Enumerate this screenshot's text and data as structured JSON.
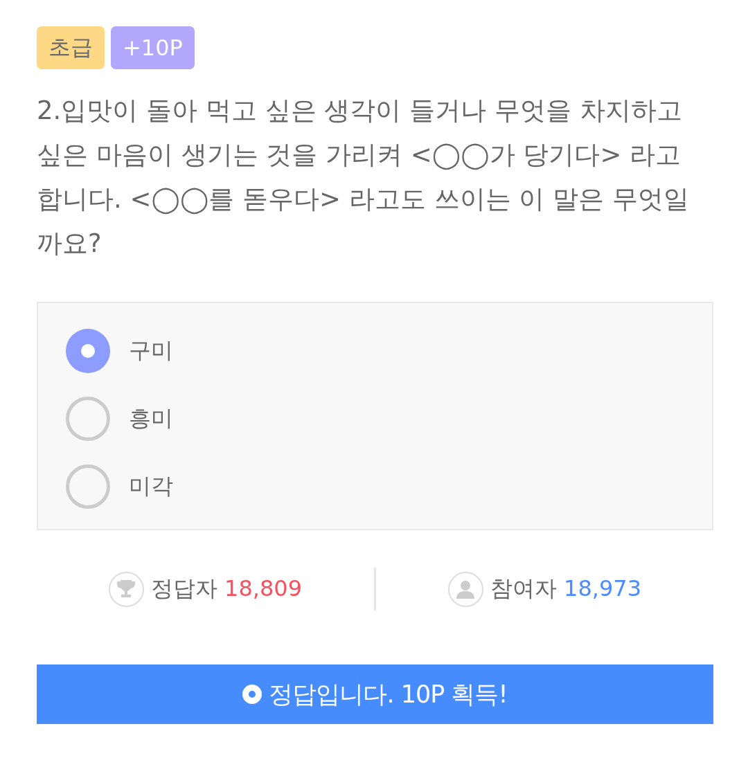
{
  "badges": [
    {
      "kind": "level",
      "label": "초급"
    },
    {
      "kind": "points",
      "label": "+10P"
    }
  ],
  "question": "2.입맛이 돌아 먹고 싶은 생각이 들거나 무엇을 차지하고 싶은 마음이 생기는 것을 가리켜 <◯◯가 당기다> 라고 합니다. <◯◯를 돋우다> 라고도 쓰이는 이 말은 무엇일까요?",
  "options": [
    {
      "label": "구미",
      "selected": true
    },
    {
      "label": "흥미",
      "selected": false
    },
    {
      "label": "미각",
      "selected": false
    }
  ],
  "stats": [
    {
      "kind": "correct",
      "label": "정답자",
      "count": "18,809"
    },
    {
      "kind": "participants",
      "label": "참여자",
      "count": "18,973"
    }
  ],
  "result_button": {
    "label": "정답입니다. 10P 획득!"
  }
}
